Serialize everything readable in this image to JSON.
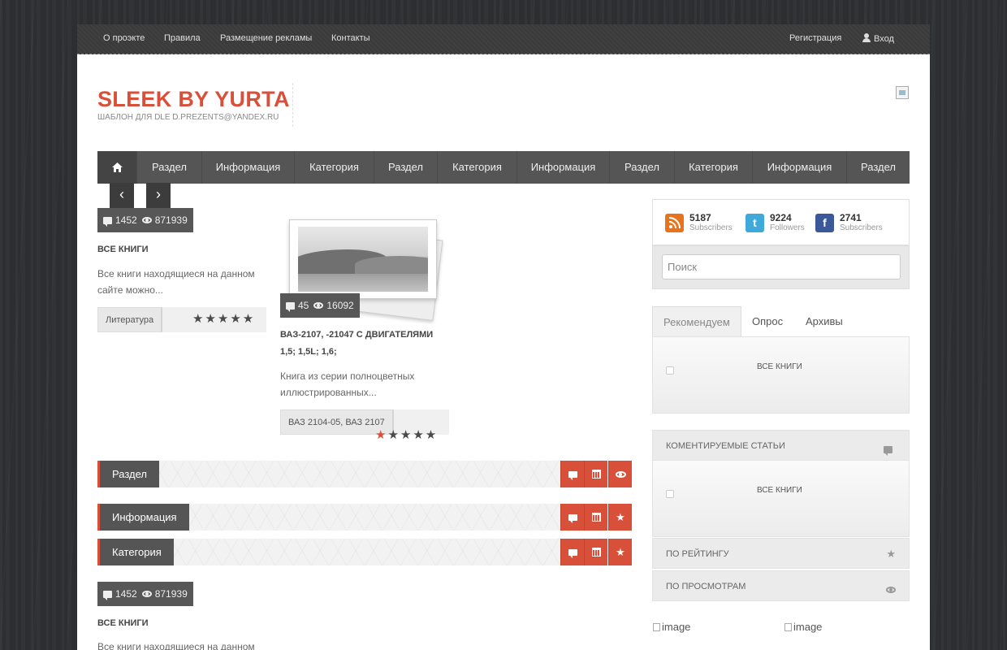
{
  "topbar": {
    "links": [
      "О проэкте",
      "Правила",
      "Размещение рекламы",
      "Контакты"
    ],
    "register": "Регистрация",
    "login": "Вход"
  },
  "header": {
    "logo": "SLEEK BY YURTA",
    "tagline": "ШАБЛОН ДЛЯ DLE D.PREZENTS@YANDEX.RU"
  },
  "nav": {
    "items": [
      "Раздел",
      "Информация",
      "Категория",
      "Раздел",
      "Категория",
      "Информация",
      "Раздел",
      "Категория",
      "Информация",
      "Раздел"
    ]
  },
  "slider": {
    "prev": "‹",
    "next": "›"
  },
  "articles": [
    {
      "comments": "1452",
      "views": "871939",
      "title": "ВСЕ КНИГИ",
      "text": "Все книги находящиеся на данном сайте можно...",
      "tag": "Литература",
      "rating": 0
    },
    {
      "comments": "45",
      "views": "16092",
      "title": "ВАЗ-2107, -21047 С ДВИГАТЕЛЯМИ 1,5; 1,5l; 1,6;",
      "text": "Книга из серии полноцветных иллюстрированных...",
      "tag": "ВАЗ 2104-05, ВАЗ 2107",
      "rating": 1
    },
    {
      "comments": "1452",
      "views": "871939",
      "title": "ВСЕ КНИГИ",
      "text": "Все книги находящиеся на данном"
    }
  ],
  "sections": [
    "Раздел",
    "Информация",
    "Категория"
  ],
  "social": [
    {
      "count": "5187",
      "label": "Subscribers",
      "color": "#e8731d"
    },
    {
      "count": "9224",
      "label": "Followers",
      "color": "#3fa9d9"
    },
    {
      "count": "2741",
      "label": "Subscribers",
      "color": "#3b5998"
    }
  ],
  "search": {
    "placeholder": "Поиск"
  },
  "tabs": [
    "Рекомендуем",
    "Опрос",
    "Архивы"
  ],
  "recommend_item": "ВСЕ КНИГИ",
  "commented": {
    "title": "КОМЕНТИРУЕМЫЕ СТАТЬИ",
    "item": "ВСЕ КНИГИ"
  },
  "by_rating": "ПО РЕЙТИНГУ",
  "by_views": "ПО ПРОСМОТРАМ",
  "images": [
    "image",
    "image"
  ],
  "colors": {
    "accent": "#d9503a",
    "dark": "#555555"
  }
}
